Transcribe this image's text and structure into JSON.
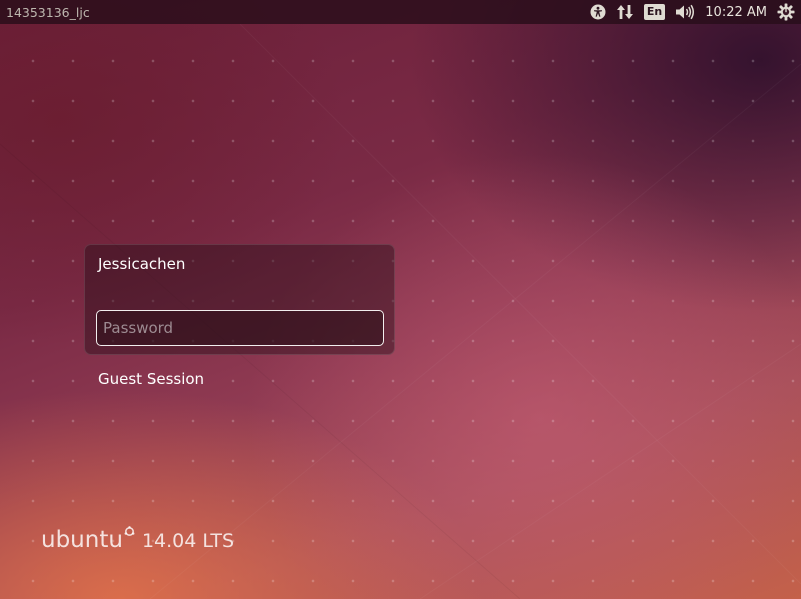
{
  "top_panel": {
    "hostname": "14353136_ljc",
    "indicators": {
      "accessibility_icon": "accessibility-icon",
      "network_icon": "network-updown-icon",
      "keyboard_layout": "En",
      "volume_icon": "volume-icon",
      "clock": "10:22 AM",
      "power_icon": "power-gear-icon"
    }
  },
  "login": {
    "user_name": "Jessicachen",
    "password_placeholder": "Password",
    "password_value": "",
    "guest_session_label": "Guest Session"
  },
  "branding": {
    "word": "ubuntu",
    "version": "14.04 LTS"
  },
  "colors": {
    "panel_bg": "#280e1a",
    "panel_text": "#dfdbd2",
    "background_primary": "#7a2a45",
    "background_accent": "#c4614a",
    "text": "#ffffff"
  }
}
